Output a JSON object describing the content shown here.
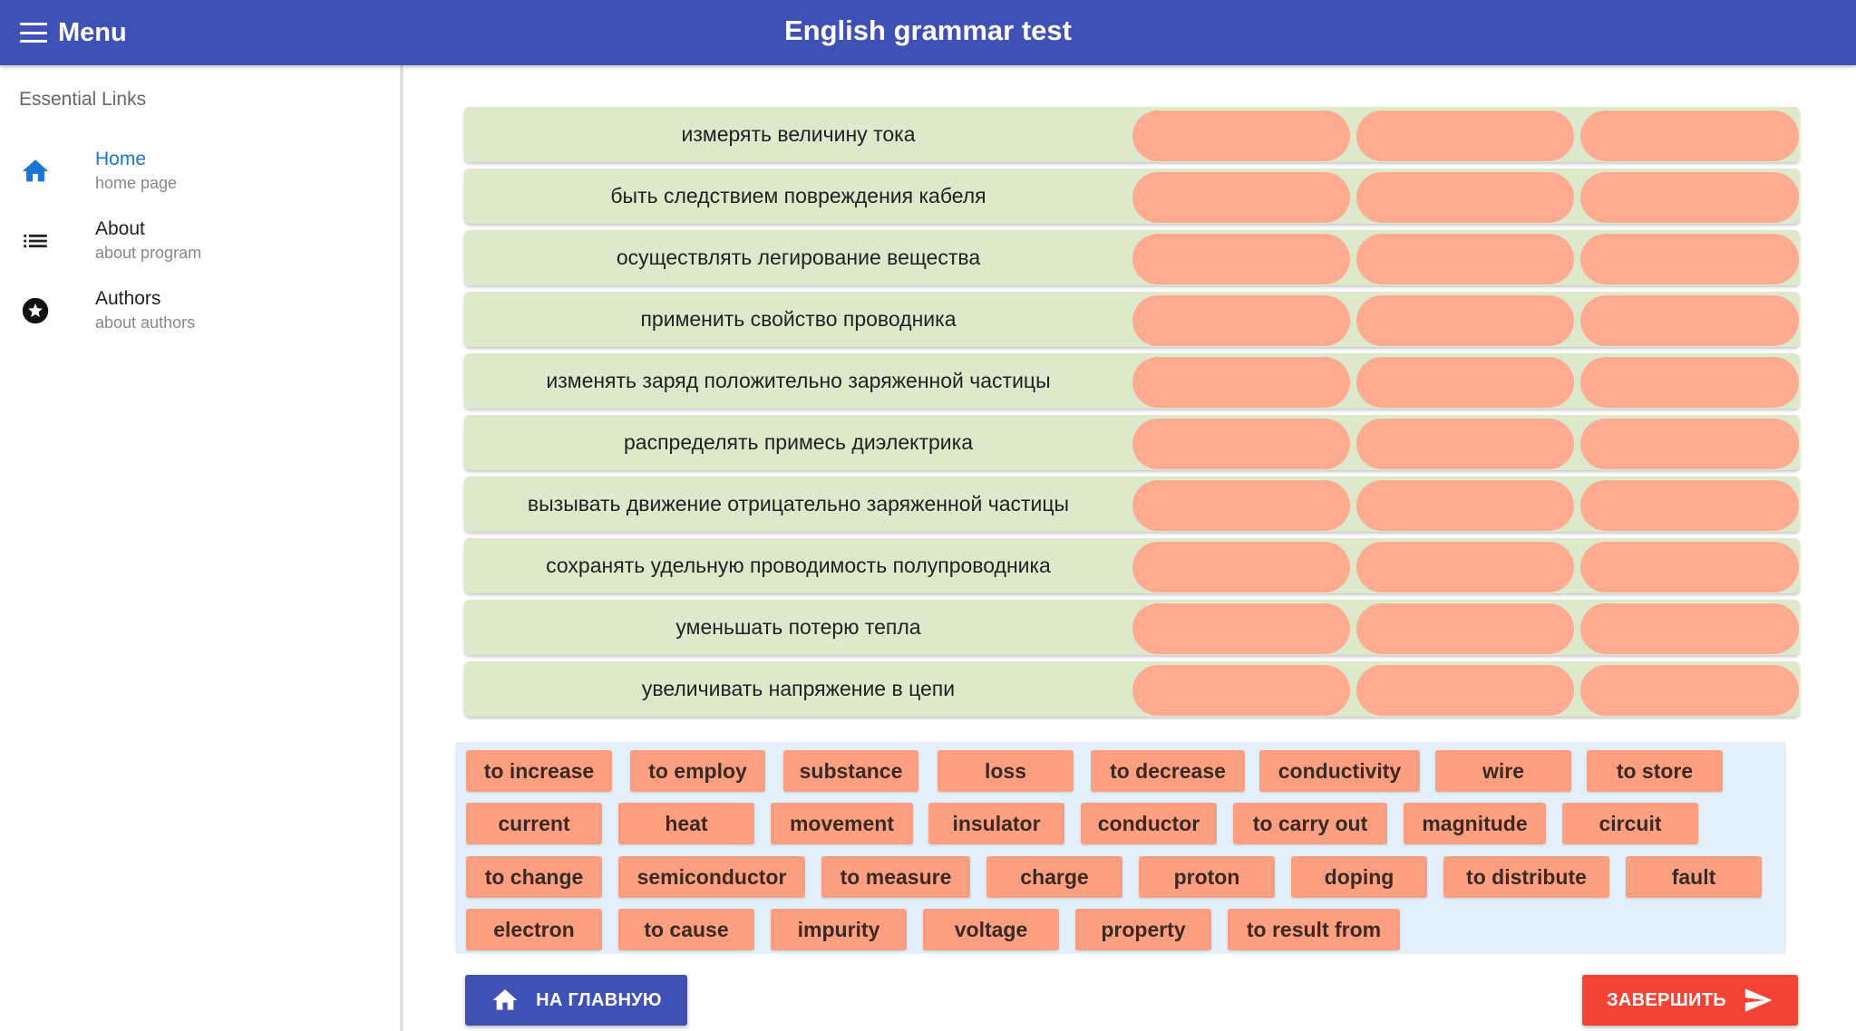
{
  "header": {
    "menu_label": "Menu",
    "title": "English grammar test",
    "bg_color": "#3f51b5"
  },
  "drawer": {
    "heading": "Essential Links",
    "items": [
      {
        "icon": "home-icon",
        "title": "Home",
        "subtitle": "home page",
        "active": true
      },
      {
        "icon": "list-icon",
        "title": "About",
        "subtitle": "about program",
        "active": false
      },
      {
        "icon": "star-icon",
        "title": "Authors",
        "subtitle": "about authors",
        "active": false
      }
    ]
  },
  "task_rows": [
    "измерять величину тока",
    "быть следствием повреждения кабеля",
    "осуществлять легирование вещества",
    "применить свойство проводника",
    "изменять заряд положительно заряженной частицы",
    "распределять примесь диэлектрика",
    "вызывать движение отрицательно заряженной частицы",
    "сохранять удельную проводимость полупроводника",
    "уменьшать потерю тепла",
    "увеличивать напряжение в цепи"
  ],
  "word_bank": [
    "to increase",
    "to employ",
    "substance",
    "loss",
    "to decrease",
    "conductivity",
    "wire",
    "to store",
    "current",
    "heat",
    "movement",
    "insulator",
    "conductor",
    "to carry out",
    "magnitude",
    "circuit",
    "to change",
    "semiconductor",
    "to measure",
    "charge",
    "proton",
    "doping",
    "to distribute",
    "fault",
    "electron",
    "to cause",
    "impurity",
    "voltage",
    "property",
    "to result from"
  ],
  "buttons": {
    "home_label": "НА ГЛАВНУЮ",
    "finish_label": "ЗАВЕРШИТЬ"
  },
  "colors": {
    "row_bg": "#dde9cb",
    "slot_bg": "#ffab91",
    "chip_bg": "#ff9f82",
    "bank_bg": "#e3f0fb",
    "finish_bg": "#f44336",
    "active_link": "#1976d2"
  }
}
